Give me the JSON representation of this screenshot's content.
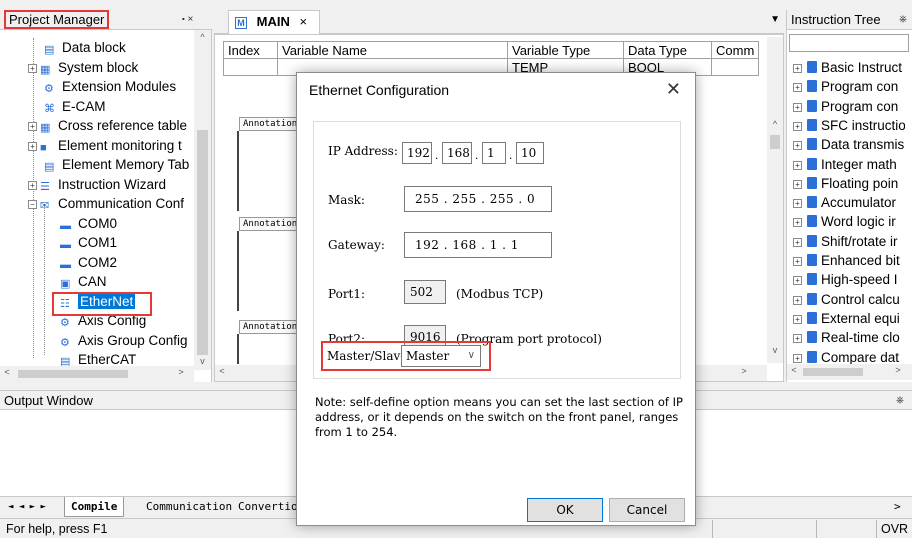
{
  "project_manager": {
    "title": "Project Manager",
    "pin": "⬝ ×",
    "items": [
      {
        "label": "Data block",
        "icon": "document-icon",
        "expander": ""
      },
      {
        "label": "System block",
        "icon": "grid-icon",
        "expander": "+"
      },
      {
        "label": "Extension Modules",
        "icon": "gear-icon",
        "expander": ""
      },
      {
        "label": "E-CAM",
        "icon": "cam-icon",
        "expander": ""
      },
      {
        "label": "Cross reference table",
        "icon": "table-icon",
        "expander": "+"
      },
      {
        "label": "Element monitoring t",
        "icon": "monitor-icon",
        "expander": "+"
      },
      {
        "label": "Element Memory Tab",
        "icon": "document-icon",
        "expander": ""
      },
      {
        "label": "Instruction Wizard",
        "icon": "list-icon",
        "expander": "+"
      },
      {
        "label": "Communication Conf",
        "icon": "communication-icon",
        "expander": "−"
      },
      {
        "label": "COM0",
        "icon": "port-icon",
        "expander": ""
      },
      {
        "label": "COM1",
        "icon": "port-icon",
        "expander": ""
      },
      {
        "label": "COM2",
        "icon": "port-icon",
        "expander": ""
      },
      {
        "label": "CAN",
        "icon": "can-icon",
        "expander": ""
      },
      {
        "label": "EtherNet",
        "icon": "network-icon",
        "expander": ""
      },
      {
        "label": "Axis Config",
        "icon": "axis-icon",
        "expander": ""
      },
      {
        "label": "Axis Group Config",
        "icon": "axis-group-icon",
        "expander": ""
      },
      {
        "label": "EtherCAT",
        "icon": "ethercat-icon",
        "expander": ""
      }
    ]
  },
  "main": {
    "tab_label": "MAIN",
    "tab_close": "×",
    "table_headers": [
      "Index",
      "Variable Name",
      "Variable Type",
      "Data Type",
      "Comm"
    ],
    "table_row": [
      "",
      "",
      "TEMP",
      "BOOL",
      ""
    ],
    "annotation_label": "Annotation"
  },
  "instruction_tree": {
    "title": "Instruction Tree",
    "items": [
      "Basic Instruct",
      "Program con",
      "Program con",
      "SFC instructio",
      "Data transmis",
      "Integer math",
      "Floating poin",
      "Accumulator",
      "Word logic ir",
      "Shift/rotate ir",
      "Enhanced bit",
      "High-speed I",
      "Control calcu",
      "External equi",
      "Real-time clo",
      "Compare dat"
    ]
  },
  "output": {
    "title": "Output Window",
    "tabs": [
      "Compile",
      "Communication",
      "Convertion"
    ],
    "nav": "◄ ◄ ► ►"
  },
  "status": {
    "help": "For help, press F1",
    "mode": "OVR"
  },
  "dialog": {
    "title": "Ethernet Configuration",
    "close": "✕",
    "ip_label": "IP Address:",
    "ip": [
      "192",
      "168",
      "1",
      "10"
    ],
    "mask_label": "Mask:",
    "mask": "255 . 255 . 255 .  0",
    "gateway_label": "Gateway:",
    "gateway": "192 . 168 .  1  .  1",
    "port1_label": "Port1:",
    "port1": "502",
    "port1_desc": "(Modbus TCP)",
    "port2_label": "Port2:",
    "port2": "9016",
    "port2_desc": "(Program port protocol)",
    "master_label": "Master/Slave:",
    "master_value": "Master",
    "note": "Note: self-define option means you can set the last section of IP address, or it depends on the switch on the front panel, ranges from 1 to 254.",
    "ok": "OK",
    "cancel": "Cancel"
  },
  "colors": {
    "highlight": "#e53935",
    "selection": "#0078d7",
    "book_icon": "#2b6fd8"
  }
}
